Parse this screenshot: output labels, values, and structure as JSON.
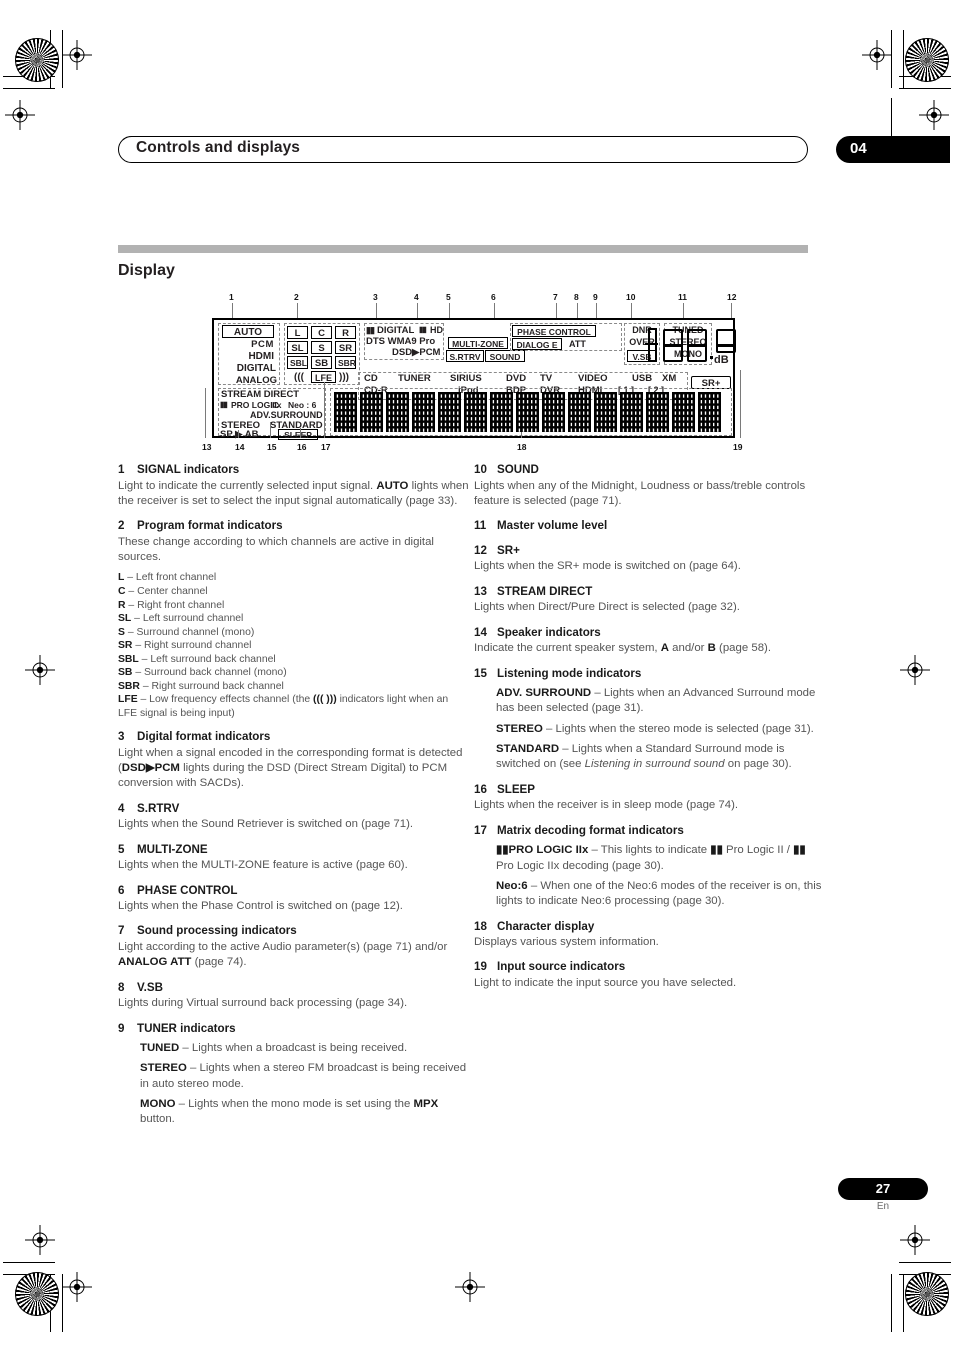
{
  "header": {
    "title": "Controls and displays",
    "chapter": "04"
  },
  "section": {
    "title": "Display"
  },
  "figure": {
    "callouts_top": [
      "1",
      "2",
      "3",
      "4",
      "5",
      "6",
      "7",
      "8",
      "9",
      "10",
      "11",
      "12"
    ],
    "callouts_bottom": [
      "13",
      "14",
      "15",
      "16",
      "17",
      "18",
      "19"
    ],
    "panel": {
      "signal": [
        "AUTO",
        "PCM",
        "HDMI",
        "DIGITAL",
        "ANALOG"
      ],
      "program_format": {
        "row1": [
          "L",
          "C",
          "R"
        ],
        "row2": [
          "SL",
          "S",
          "SR"
        ],
        "row3": [
          "SBL",
          "SB",
          "SBR"
        ],
        "lfe": "LFE",
        "lfe_left": "(((",
        "lfe_right": ")))"
      },
      "digital_format": {
        "line1_a": "DIGITAL",
        "line1_b": "HD",
        "line2": "DTS    WMA9 Pro",
        "line3": "DSD▶PCM"
      },
      "srtrv": "S.RTRV",
      "multizone": "MULTI-ZONE",
      "sound": "SOUND",
      "phase_control": "PHASE CONTROL",
      "dialog_e": "DIALOG E",
      "att": "ATT",
      "dnr": "DNR",
      "over": "OVER",
      "vsb": "V.SB",
      "tuner": [
        "TUNED",
        "STEREO",
        "MONO"
      ],
      "volume": {
        "digits": [
          "8",
          "8",
          "8"
        ],
        "unit": "dB",
        "decimal": "·"
      },
      "srplus": "SR+",
      "input_sources": {
        "row1": [
          "CD",
          "TUNER",
          "SIRIUS",
          "DVD",
          "TV",
          "VIDEO",
          "USB",
          "XM"
        ],
        "row2": [
          "CD-R",
          "iPod",
          "BDP",
          "DVR",
          "HDMI",
          "[ 1 ]",
          "[ 2 ]"
        ]
      },
      "listening": {
        "stream_direct": "STREAM DIRECT",
        "pro_logic": "PRO LOGIC",
        "iix": "IIx",
        "neo6": "Neo : 6",
        "adv_surround": "ADV.SURROUND",
        "stereo": "STEREO",
        "standard": "STANDARD",
        "sp_ab": "SP ▶ AB",
        "sleep": "SLEEP"
      },
      "character_display_cells": 14
    }
  },
  "left_column": [
    {
      "num": "1",
      "title": "SIGNAL indicators",
      "body_html": "Light to indicate the currently selected input signal. <b>AUTO</b> lights when the receiver is set to select the input signal automatically (page 33)."
    },
    {
      "num": "2",
      "title": "Program format indicators",
      "body_html": "These change according to which channels are active in digital sources.",
      "channels": [
        "<b>L</b> – Left front channel",
        "<b>C</b> – Center channel",
        "<b>R</b> – Right front channel",
        "<b>SL</b> – Left surround channel",
        "<b>S</b> – Surround channel (mono)",
        "<b>SR</b> – Right surround channel",
        "<b>SBL</b> – Left surround back channel",
        "<b>SB</b> – Surround back channel (mono)",
        "<b>SBR</b> – Right surround back channel",
        "<b>LFE</b> – Low frequency effects channel (the <b>((( )))</b> indicators light when an LFE signal is being input)"
      ]
    },
    {
      "num": "3",
      "title": "Digital format indicators",
      "body_html": "Light when a signal encoded in the corresponding format is detected (<b>DSD▶PCM</b> lights during the DSD (Direct Stream Digital) to PCM conversion with SACDs)."
    },
    {
      "num": "4",
      "title": "S.RTRV",
      "body_html": "Lights when the Sound Retriever is switched on (page 71)."
    },
    {
      "num": "5",
      "title": "MULTI-ZONE",
      "body_html": "Lights when the MULTI-ZONE feature is active (page 60)."
    },
    {
      "num": "6",
      "title": "PHASE CONTROL",
      "body_html": "Lights when the Phase Control is switched on (page 12)."
    },
    {
      "num": "7",
      "title": "Sound processing indicators",
      "body_html": "Light according to the active Audio parameter(s) (page 71) and/or <b>ANALOG ATT</b> (page 74)."
    },
    {
      "num": "8",
      "title": "V.SB",
      "body_html": "Lights during Virtual surround back processing (page 34)."
    },
    {
      "num": "9",
      "title": "TUNER indicators",
      "subitems": [
        "<b>TUNED</b> – Lights when a broadcast is being received.",
        "<b>STEREO</b> – Lights when a stereo FM broadcast is being received in auto stereo mode.",
        "<b>MONO</b> – Lights when the mono mode is set using the <b>MPX</b> button."
      ]
    }
  ],
  "right_column": [
    {
      "num": "10",
      "title": "SOUND",
      "body_html": "Lights when any of the Midnight, Loudness or bass/treble controls feature is selected (page 71)."
    },
    {
      "num": "11",
      "title": "Master volume level",
      "body_html": ""
    },
    {
      "num": "12",
      "title": "SR+",
      "body_html": "Lights when the SR+ mode is switched on (page 64)."
    },
    {
      "num": "13",
      "title": "STREAM DIRECT",
      "body_html": "Lights when Direct/Pure Direct is selected (page 32)."
    },
    {
      "num": "14",
      "title": "Speaker indicators",
      "body_html": "Indicate the current speaker system, <b>A</b> and/or <b>B</b> (page 58)."
    },
    {
      "num": "15",
      "title": "Listening mode indicators",
      "subitems": [
        "<b>ADV. SURROUND</b> – Lights when an Advanced Surround mode has been selected (page 31).",
        "<b>STEREO</b> – Lights when the stereo mode is selected (page 31).",
        "<b>STANDARD</b> – Lights when a Standard Surround mode is switched on (see <i>Listening in surround sound</i> on page 30)."
      ]
    },
    {
      "num": "16",
      "title": "SLEEP",
      "body_html": "Lights when the receiver is in sleep mode (page 74)."
    },
    {
      "num": "17",
      "title": "Matrix decoding format indicators",
      "subitems": [
        "<b>▮▮PRO LOGIC IIx</b> – This lights to indicate <b>▮▮</b> Pro Logic II / <b>▮▮</b> Pro Logic IIx decoding (page 30).",
        "<b>Neo:6</b> – When one of the Neo:6 modes of the receiver is on, this lights to indicate Neo:6 processing (page 30)."
      ]
    },
    {
      "num": "18",
      "title": "Character display",
      "body_html": "Displays various system information."
    },
    {
      "num": "19",
      "title": "Input source indicators",
      "body_html": "Light to indicate the input source you have selected."
    }
  ],
  "footer": {
    "page": "27",
    "language": "En"
  }
}
